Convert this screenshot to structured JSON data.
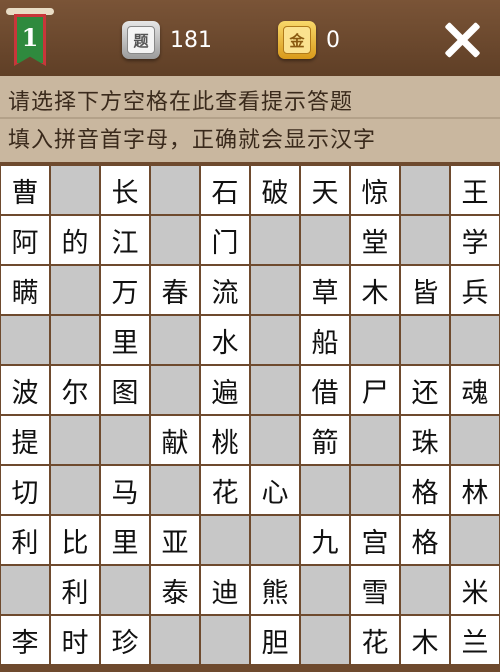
{
  "header": {
    "level": "1",
    "question_badge": "题",
    "question_count": "181",
    "gold_badge": "金",
    "gold_count": "0"
  },
  "hints": {
    "line1": "请选择下方空格在此查看提示答题",
    "line2": "填入拼音首字母，正确就会显示汉字"
  },
  "grid": [
    [
      "曹",
      "",
      "长",
      "",
      "石",
      "破",
      "天",
      "惊",
      "",
      "王"
    ],
    [
      "阿",
      "的",
      "江",
      "",
      "门",
      "",
      "",
      "堂",
      "",
      "学"
    ],
    [
      "瞒",
      "",
      "万",
      "春",
      "流",
      "",
      "草",
      "木",
      "皆",
      "兵"
    ],
    [
      "",
      "",
      "里",
      "",
      "水",
      "",
      "船",
      "",
      "",
      ""
    ],
    [
      "波",
      "尔",
      "图",
      "",
      "遍",
      "",
      "借",
      "尸",
      "还",
      "魂"
    ],
    [
      "提",
      "",
      "",
      "献",
      "桃",
      "",
      "箭",
      "",
      "珠",
      ""
    ],
    [
      "切",
      "",
      "马",
      "",
      "花",
      "心",
      "",
      "",
      "格",
      "林"
    ],
    [
      "利",
      "比",
      "里",
      "亚",
      "",
      "",
      "九",
      "宫",
      "格",
      ""
    ],
    [
      "",
      "利",
      "",
      "泰",
      "迪",
      "熊",
      "",
      "雪",
      "",
      "米"
    ],
    [
      "李",
      "时",
      "珍",
      "",
      "",
      "胆",
      "",
      "花",
      "木",
      "兰"
    ]
  ]
}
